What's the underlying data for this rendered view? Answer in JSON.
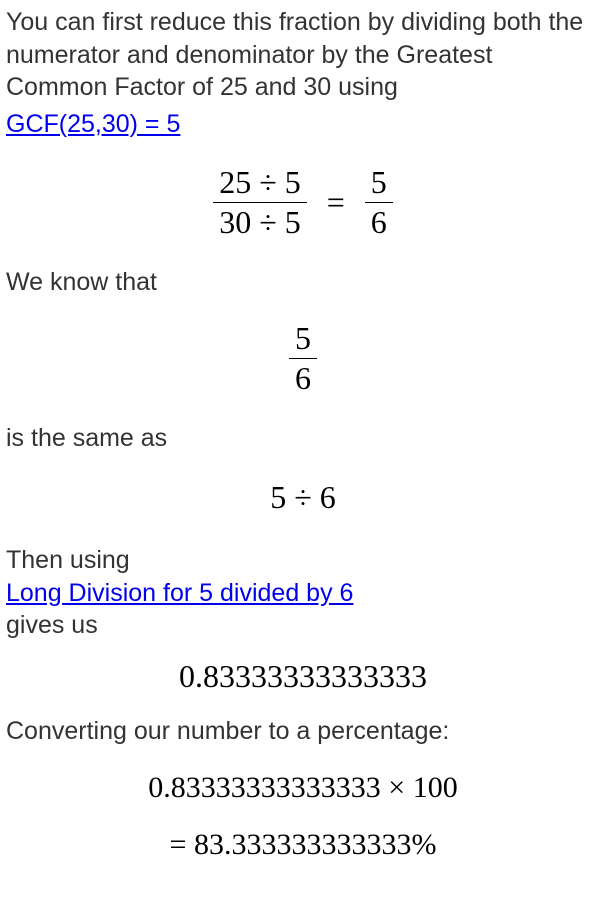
{
  "intro": {
    "text": "You can first reduce this fraction by dividing both the numerator and denominator by the Greatest Common Factor of 25 and 30 using",
    "link_text": "GCF(25,30) = 5"
  },
  "eq1": {
    "num_left": "25 ÷ 5",
    "den_left": "30 ÷ 5",
    "equals": "=",
    "num_right": "5",
    "den_right": "6"
  },
  "know_text": "We know that",
  "frac2": {
    "num": "5",
    "den": "6"
  },
  "same_text": "is the same as",
  "div_expr": "5 ÷ 6",
  "then_using": "Then using",
  "long_div_link": "Long Division for 5 divided by 6",
  "gives_us": "gives us",
  "decimal_value": "0.83333333333333",
  "convert_text": "Converting our number to a percentage:",
  "percent": {
    "line1": "0.83333333333333 × 100",
    "line2": "= 83.333333333333%"
  }
}
